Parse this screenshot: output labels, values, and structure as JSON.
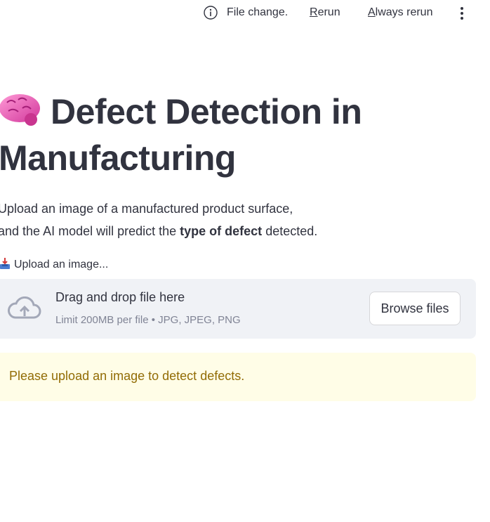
{
  "header": {
    "status_icon": "info-circle-icon",
    "status_text": "File change.",
    "rerun_key": "R",
    "rerun_rest": "erun",
    "always_key": "A",
    "always_rest": "lways rerun",
    "menu_icon": "vertical-ellipsis-icon"
  },
  "main": {
    "title_icon": "brain-emoji",
    "title": "Defect Detection in Manufacturing",
    "description_line1": "Upload an image of a manufactured product surface,",
    "description_line2_start": "and the AI model will predict the ",
    "description_line2_bold": "type of defect",
    "description_line2_end": " detected."
  },
  "uploader": {
    "label_icon": "inbox-tray-icon",
    "label": "Upload an image...",
    "drag_text": "Drag and drop file here",
    "limit_text": "Limit 200MB per file • JPG, JPEG, PNG",
    "browse_label": "Browse files"
  },
  "alert": {
    "message": "Please upload an image to detect defects."
  },
  "colors": {
    "text": "#31333f",
    "dropzone_bg": "#f0f2f6",
    "warning_bg": "#fffde7",
    "warning_text": "#926c05",
    "muted": "#808495"
  }
}
